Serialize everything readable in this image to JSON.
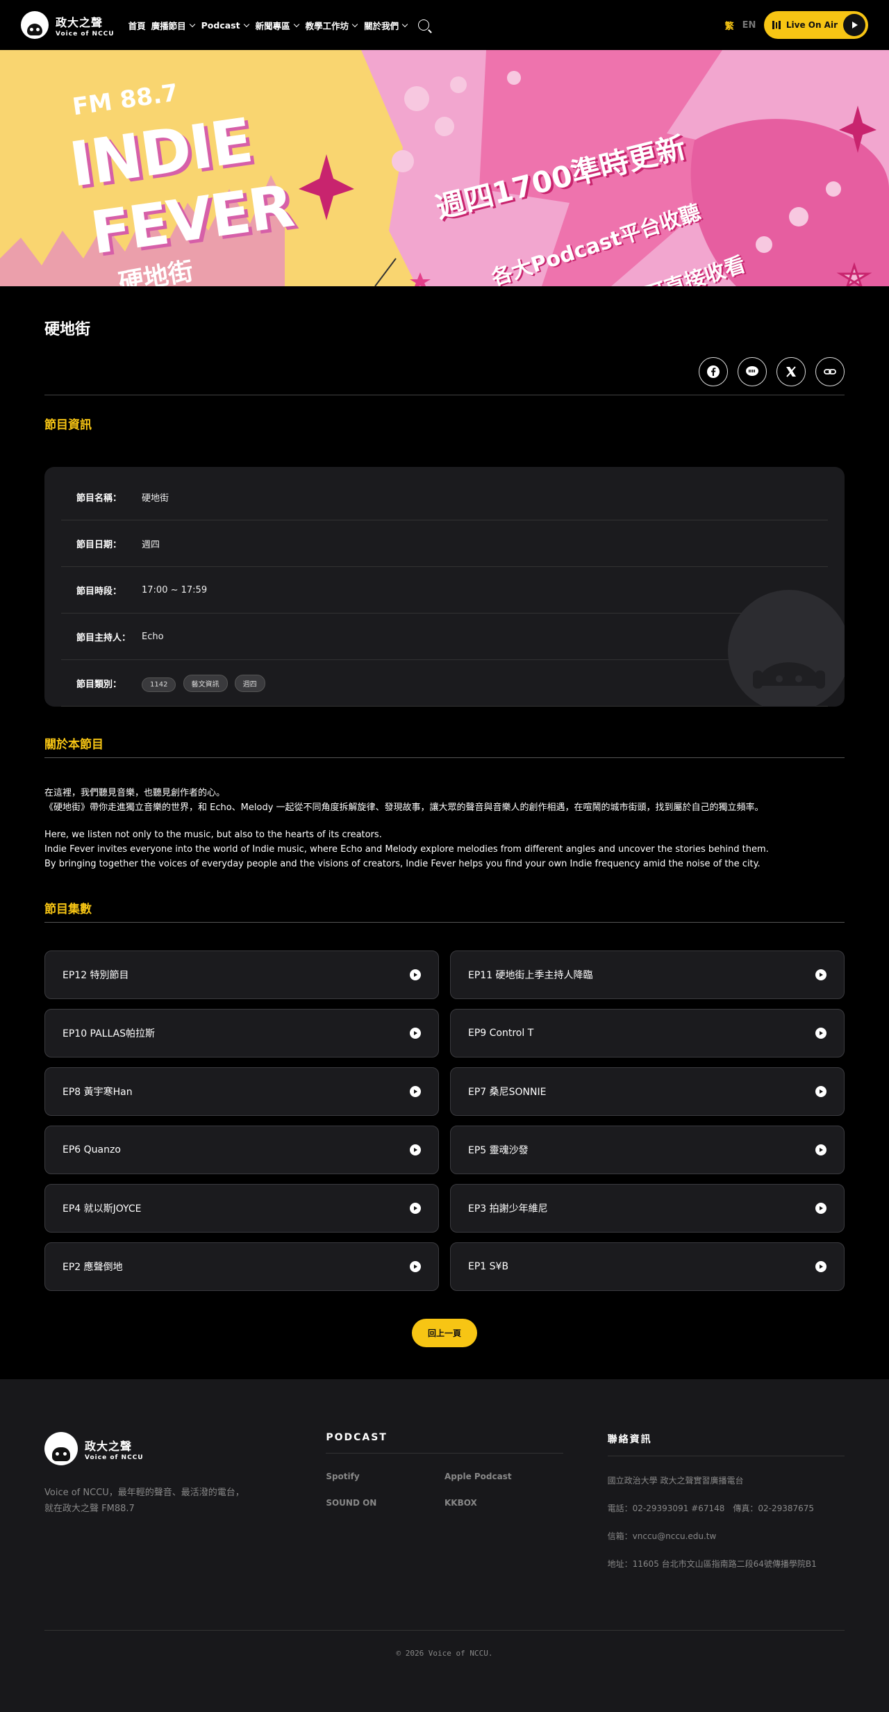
{
  "nav": {
    "logo_zh": "政大之聲",
    "logo_en": "Voice of NCCU",
    "menu": [
      {
        "label": "首頁",
        "dropdown": false
      },
      {
        "label": "廣播節目",
        "dropdown": true
      },
      {
        "label": "Podcast",
        "dropdown": true
      },
      {
        "label": "新聞專區",
        "dropdown": true
      },
      {
        "label": "教學工作坊",
        "dropdown": true
      },
      {
        "label": "關於我們",
        "dropdown": true
      }
    ],
    "lang_zh": "繁",
    "lang_en": "EN",
    "live_label": "Live On Air"
  },
  "banner": {
    "fm": "FM 88.7",
    "indie": "INDIE",
    "fever": "FEVER",
    "show_zh": "硬地街",
    "line1": "週四1700準時更新",
    "line2": "各大Podcast平台收聽",
    "line3": "YOUTUBE可直接收看"
  },
  "page": {
    "title": "硬地街",
    "share_icons": [
      "facebook-icon",
      "line-icon",
      "x-icon",
      "link-icon"
    ]
  },
  "info": {
    "section_title": "節目資訊",
    "rows": [
      {
        "label": "節目名稱：",
        "value": "硬地街"
      },
      {
        "label": "節目日期：",
        "value": "週四"
      },
      {
        "label": "節目時段：",
        "value": "17:00 ~ 17:59"
      },
      {
        "label": "節目主持人：",
        "value": "Echo"
      }
    ],
    "category_label": "節目類別：",
    "tags": [
      "1142",
      "藝文資訊",
      "週四"
    ]
  },
  "about": {
    "section_title": "關於本節目",
    "zh_1": "在這裡，我們聽見音樂，也聽見創作者的心。",
    "zh_2": "《硬地街》帶你走進獨立音樂的世界，和 Echo、Melody 一起從不同角度拆解旋律、發現故事，讓大眾的聲音與音樂人的創作相遇，在喧鬧的城市街頭，找到屬於自己的獨立頻率。",
    "en_1": "Here, we listen not only to the music, but also to the hearts of its creators.",
    "en_2": "Indie Fever invites everyone into the world of Indie music, where Echo and Melody explore melodies from different angles and uncover the stories behind them.",
    "en_3": "By bringing together the voices of everyday people and the visions of creators, Indie Fever helps you find your own Indie frequency amid the noise of the city."
  },
  "episodes": {
    "section_title": "節目集數",
    "left": [
      "EP12 特別節目",
      "EP10 PALLAS帕拉斯",
      "EP8 黃宇寒Han",
      "EP6 Quanzo",
      "EP4 就以斯JOYCE",
      "EP2 應聲倒地"
    ],
    "right": [
      "EP11 硬地街上季主持人降臨",
      "EP9 Control T",
      "EP7 桑尼SONNIE",
      "EP5 靈魂沙發",
      "EP3 拍謝少年維尼",
      "EP1 S¥B"
    ],
    "back_label": "回上一頁"
  },
  "footer": {
    "logo_zh": "政大之聲",
    "logo_en": "Voice of NCCU",
    "desc_1": "Voice of NCCU，最年輕的聲音、最活潑的電台，",
    "desc_2": "就在政大之聲 FM88.7",
    "podcast_head": "PODCAST",
    "podcast_links": [
      "Spotify",
      "Apple Podcast",
      "SOUND ON",
      "KKBOX"
    ],
    "contact_head": "聯絡資訊",
    "contact": [
      "國立政治大學 政大之聲實習廣播電台",
      "電話：02-29393091 #67148　傳真：02-29387675",
      "信箱：vnccu@nccu.edu.tw",
      "地址：11605 台北市文山區指南路二段64號傳播學院B1"
    ],
    "copyright": "© 2026 Voice of NCCU."
  }
}
